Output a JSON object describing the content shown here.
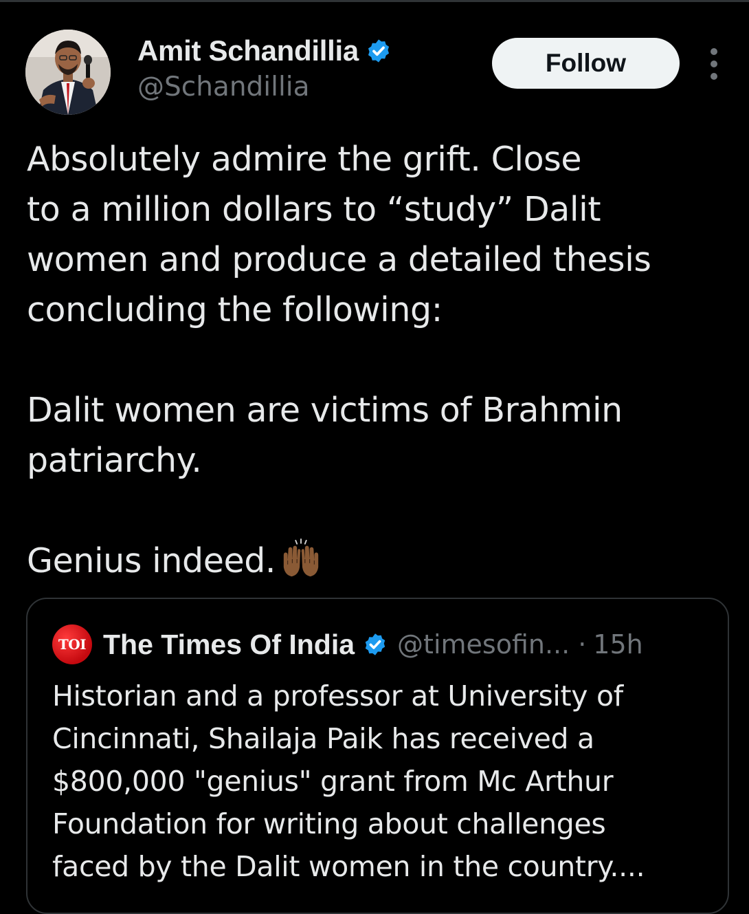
{
  "tweet": {
    "author": {
      "name": "Amit Schandillia",
      "handle": "@Schandillia",
      "verified": true,
      "avatar_icon": "profile-photo-man-with-microphone"
    },
    "follow_label": "Follow",
    "more_icon": "more-vertical-icon",
    "body_paragraphs": [
      "Absolutely admire the grift. Close\nto a million dollars to “study” Dalit\nwomen and produce a detailed thesis\nconcluding the following:",
      "Dalit women are victims of Brahmin\npatriarchy.",
      "Genius indeed."
    ],
    "body_emoji": "raising-hands-emoji"
  },
  "quoted_tweet": {
    "logo_text": "TOI",
    "author_name": "The Times Of India",
    "verified": true,
    "handle": "@timesofin...",
    "separator": "·",
    "time": "15h",
    "text": "Historian and a professor at University of\nCincinnati, Shailaja Paik has received a\n$800,000 \"genius\" grant from Mc Arthur\nFoundation for writing about challenges\nfaced by the Dalit women in the country...."
  },
  "colors": {
    "background": "#000000",
    "text_primary": "#e7e9ea",
    "text_secondary": "#71767b",
    "verified_blue": "#1d9bf0",
    "border": "#2f3336",
    "follow_button_bg": "#eff3f4",
    "toi_red": "#d7141a"
  }
}
